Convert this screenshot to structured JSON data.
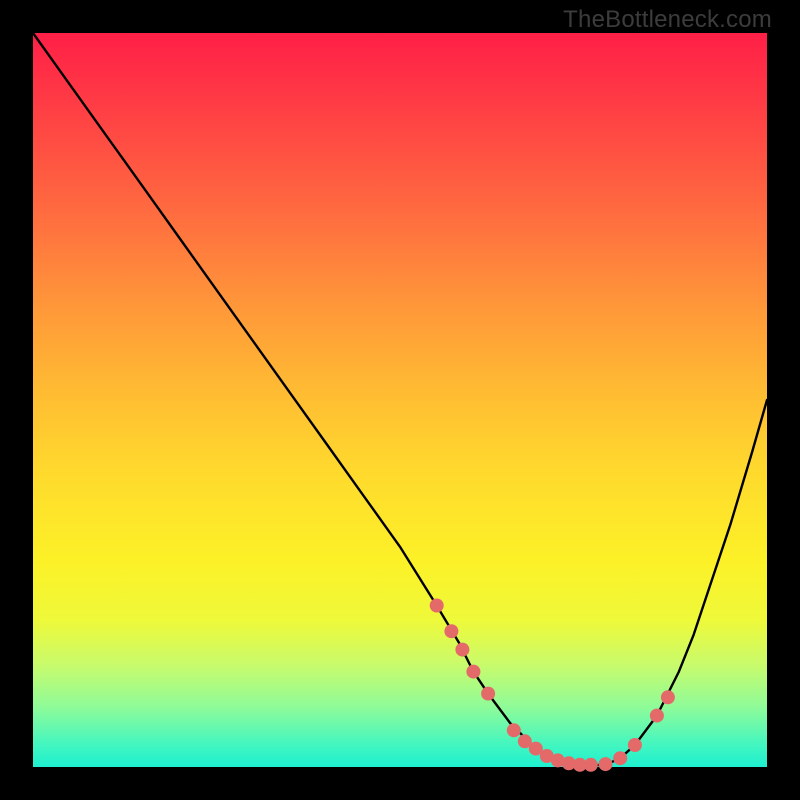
{
  "watermark": "TheBottleneck.com",
  "colors": {
    "curve_stroke": "#000000",
    "marker_fill": "#e46a6a",
    "background_frame": "#000000"
  },
  "chart_data": {
    "type": "line",
    "title": "",
    "xlabel": "",
    "ylabel": "",
    "xlim": [
      0,
      100
    ],
    "ylim": [
      0,
      100
    ],
    "series": [
      {
        "name": "bottleneck-curve",
        "x": [
          0,
          5,
          10,
          15,
          20,
          25,
          30,
          35,
          40,
          45,
          50,
          55,
          58,
          60,
          62,
          65,
          68,
          70,
          72,
          75,
          78,
          80,
          82,
          85,
          88,
          90,
          92,
          95,
          98,
          100
        ],
        "y": [
          100,
          93,
          86,
          79,
          72,
          65,
          58,
          51,
          44,
          37,
          30,
          22,
          17,
          13,
          10,
          6,
          3,
          1.5,
          0.7,
          0.2,
          0.3,
          1.2,
          3,
          7,
          13,
          18,
          24,
          33,
          43,
          50
        ]
      }
    ],
    "markers": {
      "name": "highlight-points",
      "x": [
        55,
        57,
        58.5,
        60,
        62,
        65.5,
        67,
        68.5,
        70,
        71.5,
        73,
        74.5,
        76,
        78,
        80,
        82,
        85,
        86.5
      ],
      "y": [
        22,
        18.5,
        16,
        13,
        10,
        5,
        3.5,
        2.5,
        1.5,
        0.9,
        0.5,
        0.3,
        0.3,
        0.4,
        1.2,
        3,
        7,
        9.5
      ]
    }
  }
}
